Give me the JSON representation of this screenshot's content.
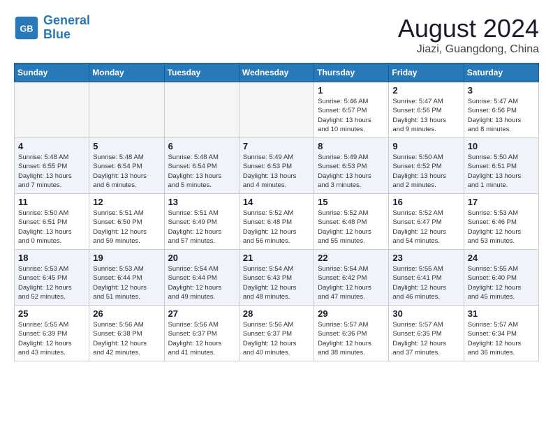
{
  "header": {
    "logo_line1": "General",
    "logo_line2": "Blue",
    "title": "August 2024",
    "subtitle": "Jiazi, Guangdong, China"
  },
  "weekdays": [
    "Sunday",
    "Monday",
    "Tuesday",
    "Wednesday",
    "Thursday",
    "Friday",
    "Saturday"
  ],
  "weeks": [
    [
      {
        "day": "",
        "info": ""
      },
      {
        "day": "",
        "info": ""
      },
      {
        "day": "",
        "info": ""
      },
      {
        "day": "",
        "info": ""
      },
      {
        "day": "1",
        "info": "Sunrise: 5:46 AM\nSunset: 6:57 PM\nDaylight: 13 hours\nand 10 minutes."
      },
      {
        "day": "2",
        "info": "Sunrise: 5:47 AM\nSunset: 6:56 PM\nDaylight: 13 hours\nand 9 minutes."
      },
      {
        "day": "3",
        "info": "Sunrise: 5:47 AM\nSunset: 6:56 PM\nDaylight: 13 hours\nand 8 minutes."
      }
    ],
    [
      {
        "day": "4",
        "info": "Sunrise: 5:48 AM\nSunset: 6:55 PM\nDaylight: 13 hours\nand 7 minutes."
      },
      {
        "day": "5",
        "info": "Sunrise: 5:48 AM\nSunset: 6:54 PM\nDaylight: 13 hours\nand 6 minutes."
      },
      {
        "day": "6",
        "info": "Sunrise: 5:48 AM\nSunset: 6:54 PM\nDaylight: 13 hours\nand 5 minutes."
      },
      {
        "day": "7",
        "info": "Sunrise: 5:49 AM\nSunset: 6:53 PM\nDaylight: 13 hours\nand 4 minutes."
      },
      {
        "day": "8",
        "info": "Sunrise: 5:49 AM\nSunset: 6:53 PM\nDaylight: 13 hours\nand 3 minutes."
      },
      {
        "day": "9",
        "info": "Sunrise: 5:50 AM\nSunset: 6:52 PM\nDaylight: 13 hours\nand 2 minutes."
      },
      {
        "day": "10",
        "info": "Sunrise: 5:50 AM\nSunset: 6:51 PM\nDaylight: 13 hours\nand 1 minute."
      }
    ],
    [
      {
        "day": "11",
        "info": "Sunrise: 5:50 AM\nSunset: 6:51 PM\nDaylight: 13 hours\nand 0 minutes."
      },
      {
        "day": "12",
        "info": "Sunrise: 5:51 AM\nSunset: 6:50 PM\nDaylight: 12 hours\nand 59 minutes."
      },
      {
        "day": "13",
        "info": "Sunrise: 5:51 AM\nSunset: 6:49 PM\nDaylight: 12 hours\nand 57 minutes."
      },
      {
        "day": "14",
        "info": "Sunrise: 5:52 AM\nSunset: 6:48 PM\nDaylight: 12 hours\nand 56 minutes."
      },
      {
        "day": "15",
        "info": "Sunrise: 5:52 AM\nSunset: 6:48 PM\nDaylight: 12 hours\nand 55 minutes."
      },
      {
        "day": "16",
        "info": "Sunrise: 5:52 AM\nSunset: 6:47 PM\nDaylight: 12 hours\nand 54 minutes."
      },
      {
        "day": "17",
        "info": "Sunrise: 5:53 AM\nSunset: 6:46 PM\nDaylight: 12 hours\nand 53 minutes."
      }
    ],
    [
      {
        "day": "18",
        "info": "Sunrise: 5:53 AM\nSunset: 6:45 PM\nDaylight: 12 hours\nand 52 minutes."
      },
      {
        "day": "19",
        "info": "Sunrise: 5:53 AM\nSunset: 6:44 PM\nDaylight: 12 hours\nand 51 minutes."
      },
      {
        "day": "20",
        "info": "Sunrise: 5:54 AM\nSunset: 6:44 PM\nDaylight: 12 hours\nand 49 minutes."
      },
      {
        "day": "21",
        "info": "Sunrise: 5:54 AM\nSunset: 6:43 PM\nDaylight: 12 hours\nand 48 minutes."
      },
      {
        "day": "22",
        "info": "Sunrise: 5:54 AM\nSunset: 6:42 PM\nDaylight: 12 hours\nand 47 minutes."
      },
      {
        "day": "23",
        "info": "Sunrise: 5:55 AM\nSunset: 6:41 PM\nDaylight: 12 hours\nand 46 minutes."
      },
      {
        "day": "24",
        "info": "Sunrise: 5:55 AM\nSunset: 6:40 PM\nDaylight: 12 hours\nand 45 minutes."
      }
    ],
    [
      {
        "day": "25",
        "info": "Sunrise: 5:55 AM\nSunset: 6:39 PM\nDaylight: 12 hours\nand 43 minutes."
      },
      {
        "day": "26",
        "info": "Sunrise: 5:56 AM\nSunset: 6:38 PM\nDaylight: 12 hours\nand 42 minutes."
      },
      {
        "day": "27",
        "info": "Sunrise: 5:56 AM\nSunset: 6:37 PM\nDaylight: 12 hours\nand 41 minutes."
      },
      {
        "day": "28",
        "info": "Sunrise: 5:56 AM\nSunset: 6:37 PM\nDaylight: 12 hours\nand 40 minutes."
      },
      {
        "day": "29",
        "info": "Sunrise: 5:57 AM\nSunset: 6:36 PM\nDaylight: 12 hours\nand 38 minutes."
      },
      {
        "day": "30",
        "info": "Sunrise: 5:57 AM\nSunset: 6:35 PM\nDaylight: 12 hours\nand 37 minutes."
      },
      {
        "day": "31",
        "info": "Sunrise: 5:57 AM\nSunset: 6:34 PM\nDaylight: 12 hours\nand 36 minutes."
      }
    ]
  ]
}
